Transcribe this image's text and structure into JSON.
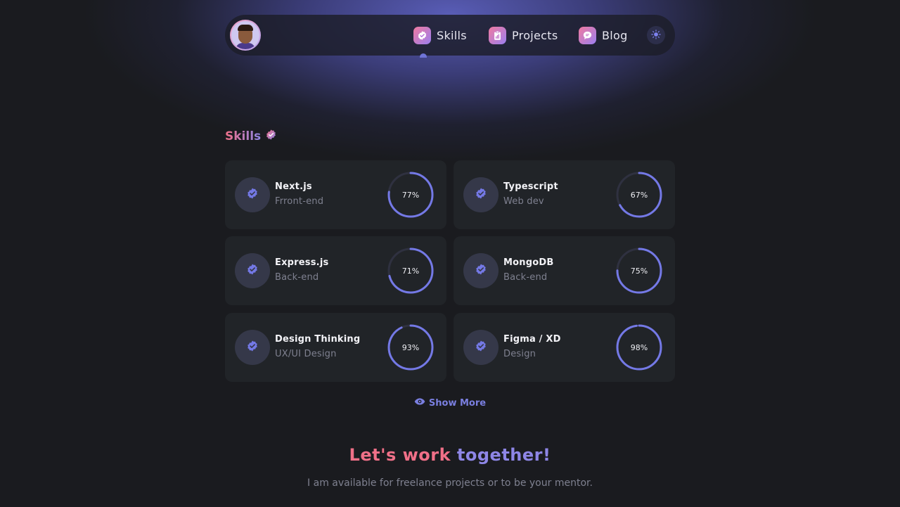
{
  "nav": {
    "items": [
      {
        "label": "Skills",
        "icon": "verified-badge-icon"
      },
      {
        "label": "Projects",
        "icon": "clipboard-chart-icon"
      },
      {
        "label": "Blog",
        "icon": "chat-bubble-icon"
      }
    ],
    "theme_toggle_icon": "sun-icon"
  },
  "skills": {
    "title": "Skills",
    "cards": [
      {
        "name": "Next.js",
        "category": "Frront-end",
        "percent": 77,
        "percent_label": "77%"
      },
      {
        "name": "Typescript",
        "category": "Web dev",
        "percent": 67,
        "percent_label": "67%"
      },
      {
        "name": "Express.js",
        "category": "Back-end",
        "percent": 71,
        "percent_label": "71%"
      },
      {
        "name": "MongoDB",
        "category": "Back-end",
        "percent": 75,
        "percent_label": "75%"
      },
      {
        "name": "Design Thinking",
        "category": "UX/UI Design",
        "percent": 93,
        "percent_label": "93%"
      },
      {
        "name": "Figma / XD",
        "category": "Design",
        "percent": 98,
        "percent_label": "98%"
      }
    ],
    "show_more_label": "Show More"
  },
  "cta": {
    "title_part1": "Let's work",
    "title_part2": "together!",
    "subtitle": "I am available for freelance projects or to be your mentor."
  },
  "colors": {
    "accent": "#6f74d6",
    "gradient_start": "#f07088",
    "gradient_end": "#8e86e6",
    "card_bg": "#212428",
    "page_bg": "#1a1b1f"
  }
}
